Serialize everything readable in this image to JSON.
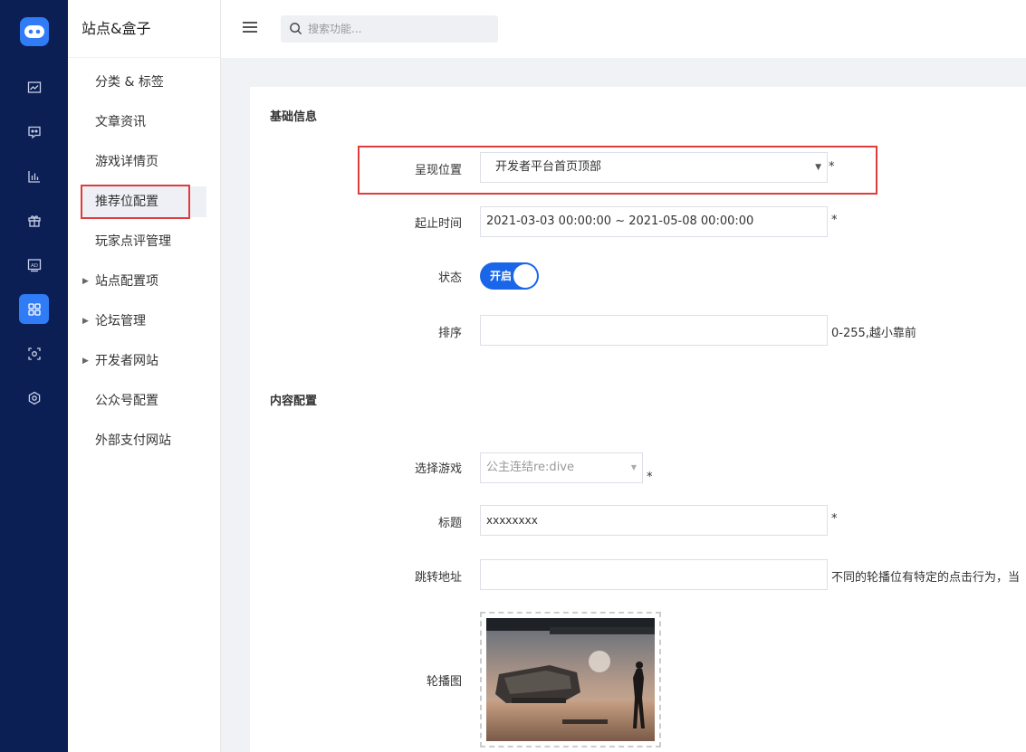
{
  "rail": {
    "icons": [
      "gamepad-logo-icon",
      "line-chart-icon",
      "message-board-icon",
      "bar-chart-icon",
      "gift-icon",
      "ad-icon",
      "grid-apps-icon",
      "scan-icon",
      "settings-icon"
    ]
  },
  "sidebar": {
    "title": "站点&盒子",
    "items": [
      {
        "label": "分类 & 标签"
      },
      {
        "label": "文章资讯"
      },
      {
        "label": "游戏详情页"
      },
      {
        "label": "推荐位配置"
      },
      {
        "label": "玩家点评管理"
      },
      {
        "label": "站点配置项"
      },
      {
        "label": "论坛管理"
      },
      {
        "label": "开发者网站"
      },
      {
        "label": "公众号配置"
      },
      {
        "label": "外部支付网站"
      }
    ]
  },
  "topbar": {
    "search_placeholder": "搜索功能..."
  },
  "form": {
    "section_basic": "基础信息",
    "position_label": "呈现位置",
    "position_value": "开发者平台首页顶部",
    "time_label": "起止时间",
    "time_value": "2021-03-03 00:00:00 ~ 2021-05-08 00:00:00",
    "status_label": "状态",
    "status_value": "开启",
    "sort_label": "排序",
    "sort_value": "",
    "sort_hint": "0-255,越小靠前",
    "section_content": "内容配置",
    "game_label": "选择游戏",
    "game_value": "公主连结re:dive",
    "title_label": "标题",
    "title_value": "xxxxxxxx",
    "jump_label": "跳转地址",
    "jump_value": "",
    "jump_hint": "不同的轮播位有特定的点击行为，当",
    "carousel_label": "轮播图",
    "required_mark": "*"
  },
  "colors": {
    "rail_bg": "#0c1f55",
    "accent": "#2f7cf6",
    "toggle_on": "#1a66e8",
    "highlight_red": "#e03c3c"
  }
}
